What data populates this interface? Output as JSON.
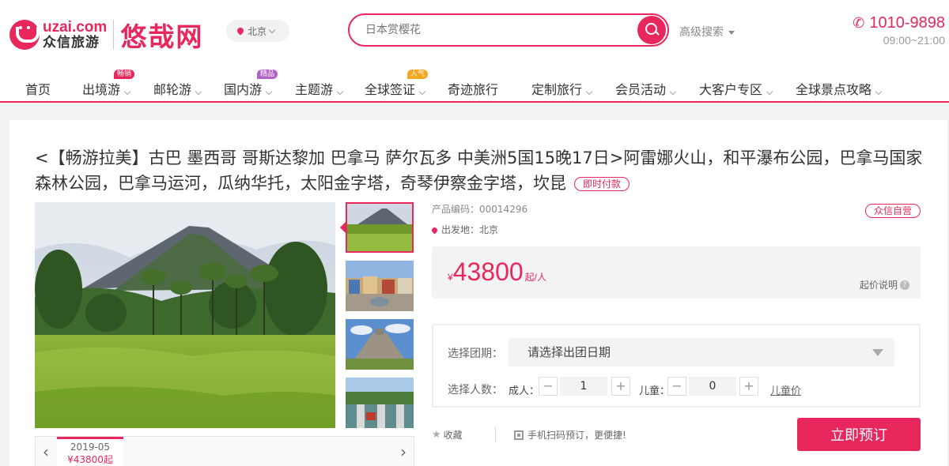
{
  "header": {
    "logo_en": "uzai.com",
    "logo_cn": "众信旅游",
    "brand": "悠哉网",
    "city": "北京",
    "search_placeholder": "日本赏樱花",
    "advanced_search": "高级搜索",
    "phone": "1010-9898",
    "hours": "09:00~21:00"
  },
  "nav": {
    "items": [
      {
        "label": "首页"
      },
      {
        "label": "出境游",
        "badge": "畅销"
      },
      {
        "label": "邮轮游"
      },
      {
        "label": "国内游",
        "badge": "精品"
      },
      {
        "label": "主题游"
      },
      {
        "label": "全球签证",
        "badge": "人气"
      },
      {
        "label": "奇迹旅行"
      },
      {
        "label": "定制旅行"
      },
      {
        "label": "会员活动"
      },
      {
        "label": "大客户专区"
      },
      {
        "label": "全球景点攻略"
      }
    ]
  },
  "product": {
    "title": "<【畅游拉美】古巴 墨西哥 哥斯达黎加 巴拿马 萨尔瓦多 中美洲5国15晚17日>阿雷娜火山，和平瀑布公园，巴拿马国家森林公园，巴拿马运河，瓜纳华托，太阳金字塔，奇琴伊察金字塔，坎昆",
    "pay_tag": "即时付款",
    "code_label": "产品编码：",
    "code": "00014296",
    "departure_label": "出发地：",
    "departure": "北京",
    "self_operated": "众信自营",
    "currency": "¥",
    "price": "43800",
    "price_unit": "起/人",
    "price_note": "起价说明",
    "select_date_label": "选择团期：",
    "select_date_placeholder": "请选择出团日期",
    "select_pax_label": "选择人数：",
    "adult_label": "成人：",
    "adult_count": "1",
    "child_label": "儿童：",
    "child_count": "0",
    "child_price_link": "儿童价",
    "favorite": "收藏",
    "qr_text": "手机扫码预订，更便捷!",
    "book_button": "立即预订"
  },
  "date_strip": {
    "month": "2019-05",
    "price": "¥43800起"
  },
  "colors": {
    "accent": "#e8285d",
    "badge_hot": "#e8285d",
    "badge_fine": "#b062c6",
    "badge_pop": "#f5a623"
  }
}
